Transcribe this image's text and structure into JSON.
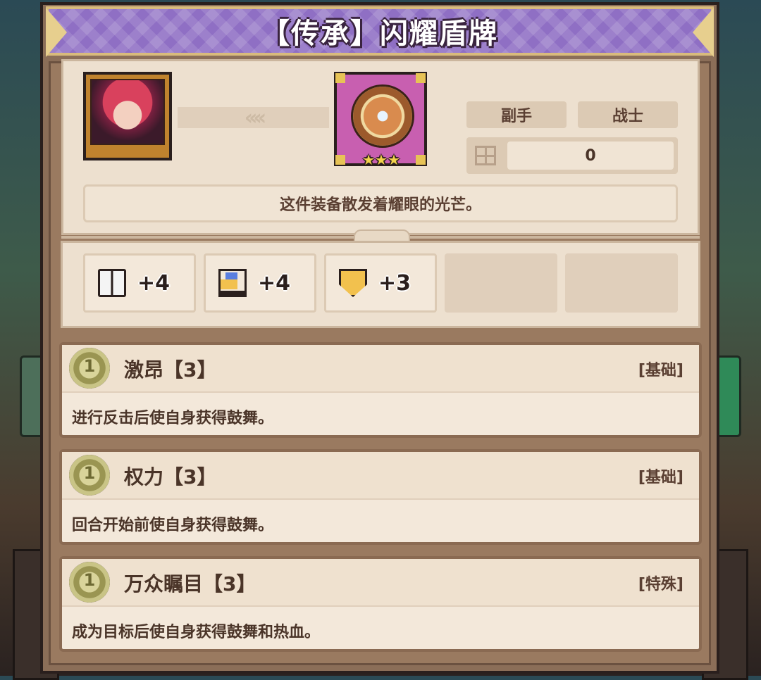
{
  "title": "【传承】闪耀盾牌",
  "equipment": {
    "arrow_indicator": "‹‹‹‹",
    "stars": "★★★",
    "slot": "副手",
    "class": "战士",
    "count": "0",
    "description": "这件装备散发着耀眼的光芒。"
  },
  "stats": [
    {
      "icon": "book-icon",
      "value": "+4"
    },
    {
      "icon": "boot-icon",
      "value": "+4"
    },
    {
      "icon": "shield-icon",
      "value": "+3"
    }
  ],
  "skills": [
    {
      "coin": "1",
      "name": "激昂【3】",
      "type": "[基础]",
      "desc": "进行反击后使自身获得鼓舞。"
    },
    {
      "coin": "1",
      "name": "权力【3】",
      "type": "[基础]",
      "desc": "回合开始前使自身获得鼓舞。"
    },
    {
      "coin": "1",
      "name": "万众瞩目【3】",
      "type": "[特殊]",
      "desc": "成为目标后使自身获得鼓舞和热血。"
    }
  ],
  "colors": {
    "title_bar": "#8f6fc4",
    "panel_wood": "#8b6e58",
    "parchment": "#ede0cf",
    "item_frame": "#c85fb0",
    "coin": "#c9c486"
  }
}
